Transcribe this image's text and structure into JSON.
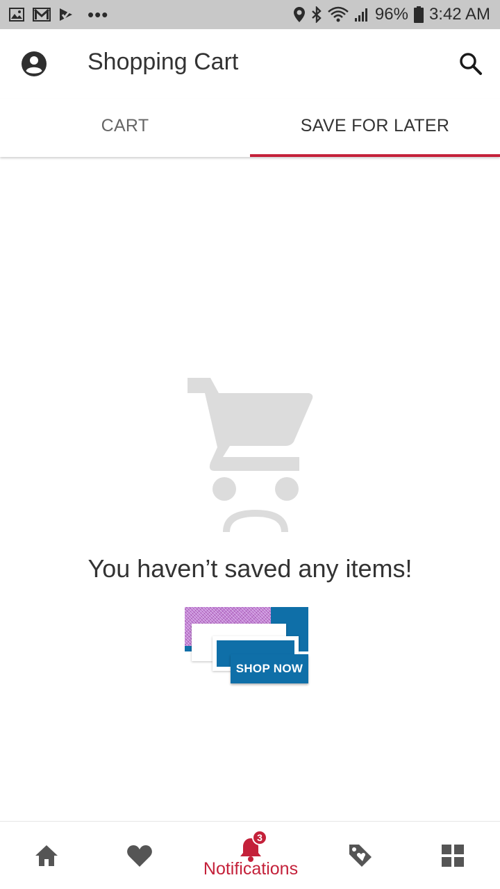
{
  "status_bar": {
    "battery": "96%",
    "time": "3:42 AM",
    "overflow": "•••"
  },
  "header": {
    "title": "Shopping Cart"
  },
  "tabs": [
    {
      "label": "CART",
      "selected": false
    },
    {
      "label": "SAVE FOR LATER",
      "selected": true
    }
  ],
  "empty_state": {
    "message": "You haven’t saved any items!",
    "button_label": "SHOP NOW"
  },
  "bottom_nav": {
    "items": [
      {
        "icon": "home-icon"
      },
      {
        "icon": "heart-icon"
      },
      {
        "icon": "bell-icon",
        "label": "Notifications",
        "badge": "3",
        "active": true
      },
      {
        "icon": "tag-icon"
      },
      {
        "icon": "grid-icon"
      }
    ]
  },
  "colors": {
    "accent": "#c4213a",
    "button": "#0f6fa8",
    "status_bar": "#c8c8c8",
    "empty_icon": "#dcdcdc"
  }
}
